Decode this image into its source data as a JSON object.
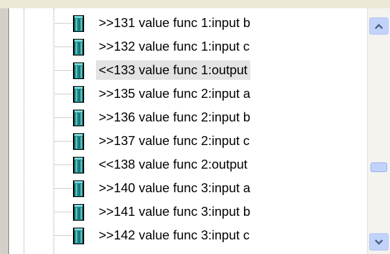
{
  "tree": {
    "items": [
      {
        "label": ">>131 value func 1:input b",
        "icon": "node-icon",
        "selected": false
      },
      {
        "label": ">>132 value func 1:input c",
        "icon": "node-icon",
        "selected": false
      },
      {
        "label": "<<133 value func 1:output",
        "icon": "node-icon",
        "selected": true
      },
      {
        "label": ">>135 value func 2:input a",
        "icon": "node-icon",
        "selected": false
      },
      {
        "label": ">>136 value func 2:input b",
        "icon": "node-icon",
        "selected": false
      },
      {
        "label": ">>137 value func 2:input c",
        "icon": "node-icon",
        "selected": false
      },
      {
        "label": "<<138 value func 2:output",
        "icon": "node-icon",
        "selected": false
      },
      {
        "label": ">>140 value func 3:input a",
        "icon": "node-icon",
        "selected": false
      },
      {
        "label": ">>141 value func 3:input b",
        "icon": "node-icon",
        "selected": false
      },
      {
        "label": ">>142 value func 3:input c",
        "icon": "node-icon",
        "selected": false
      }
    ]
  },
  "scrollbar": {
    "up_icon": "chevron-up-icon",
    "down_icon": "chevron-down-icon",
    "position": 0.62
  },
  "colors": {
    "selection": "#e3e3e3",
    "scroll_button": "#c1d3fb",
    "icon_teal": "#1a8c8c"
  }
}
